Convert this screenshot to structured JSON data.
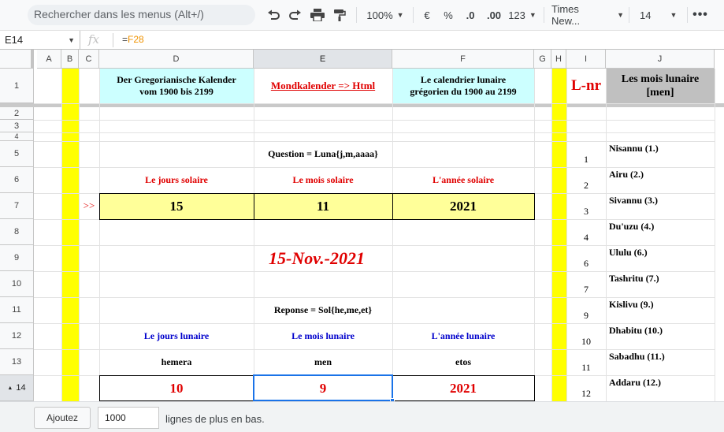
{
  "toolbar": {
    "search_placeholder": "Rechercher dans les menus (Alt+/)",
    "zoom": "100%",
    "currency": "€",
    "percent": "%",
    "decrease_decimals": ".0",
    "increase_decimals": ".00",
    "more_formats": "123",
    "font": "Times New...",
    "font_size": "14"
  },
  "formula_bar": {
    "cell_ref": "E14",
    "fx": "fx",
    "formula_eq": "=",
    "formula_ref": "F28"
  },
  "columns": [
    "A",
    "B",
    "C",
    "D",
    "E",
    "F",
    "G",
    "H",
    "I",
    "J"
  ],
  "selected_column": "E",
  "rows": [
    "1",
    "2",
    "3",
    "4",
    "5",
    "6",
    "7",
    "8",
    "9",
    "10",
    "11",
    "12",
    "13",
    "14"
  ],
  "selected_row": "14",
  "sheet": {
    "d1": "Der Gregorianische Kalender vom 1900 bis 2199",
    "e1": "Mondkalender => Html",
    "f1": "Le calendrier lunaire grégorien du 1900 au 2199",
    "i1": "L-nr",
    "j1": "Les mois lunaire [men]",
    "question": "Question = Luna{j,m,aaaa}",
    "d6": "Le jours solaire",
    "e6": "Le mois solaire",
    "f6": "L'année solaire",
    "c7": ">>",
    "d7": "15",
    "e7": "11",
    "f7": "2021",
    "date": "15-Nov.-2021",
    "reponse": "Reponse = Sol{he,me,et}",
    "d12": "Le jours lunaire",
    "e12": "Le mois lunaire",
    "f12": "L'année lunaire",
    "d13": "hemera",
    "e13": "men",
    "f13": "etos",
    "d14": "10",
    "e14": "9",
    "f14": "2021"
  },
  "months": [
    {
      "nr": "1",
      "name": "Nisannu (1.)"
    },
    {
      "nr": "2",
      "name": "Airu (2.)"
    },
    {
      "nr": "3",
      "name": "Sivannu (3.)"
    },
    {
      "nr": "4",
      "name": "Du'uzu (4.)"
    },
    {
      "nr": "6",
      "name": "Ululu (6.)"
    },
    {
      "nr": "7",
      "name": "Tashritu (7.)"
    },
    {
      "nr": "9",
      "name": "Kislivu (9.)"
    },
    {
      "nr": "10",
      "name": "Dhabitu (10.)"
    },
    {
      "nr": "11",
      "name": "Sabadhu (11.)"
    },
    {
      "nr": "12",
      "name": "Addaru (12.)"
    }
  ],
  "bottom": {
    "add_button": "Ajoutez",
    "rows_count": "1000",
    "rows_text": "lignes de plus en bas."
  },
  "colors": {
    "yellow_column": "#ffff00",
    "light_cyan": "#ccffff",
    "light_yellow": "#ffff99",
    "header_gray": "#c0c0c0",
    "red": "#e00000",
    "blue": "#0000cc",
    "selection_blue": "#1a73e8"
  }
}
